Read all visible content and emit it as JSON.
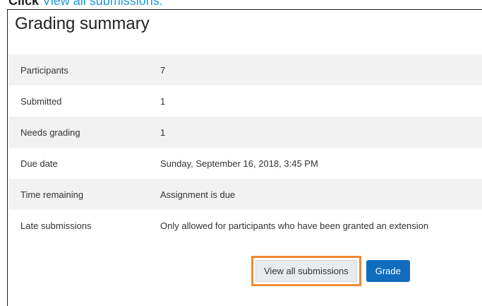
{
  "instruction": {
    "lead": "Click",
    "link": "View all submissions."
  },
  "summary": {
    "title": "Grading summary",
    "rows": [
      {
        "label": "Participants",
        "value": "7"
      },
      {
        "label": "Submitted",
        "value": "1"
      },
      {
        "label": "Needs grading",
        "value": "1"
      },
      {
        "label": "Due date",
        "value": "Sunday, September 16, 2018, 3:45 PM"
      },
      {
        "label": "Time remaining",
        "value": "Assignment is due"
      },
      {
        "label": "Late submissions",
        "value": "Only allowed for participants who have been granted an extension"
      }
    ]
  },
  "buttons": {
    "view_all": "View all submissions",
    "grade": "Grade"
  },
  "colors": {
    "highlight": "#f08a32",
    "primary": "#0f6cbf",
    "link": "#1f9ad6"
  }
}
